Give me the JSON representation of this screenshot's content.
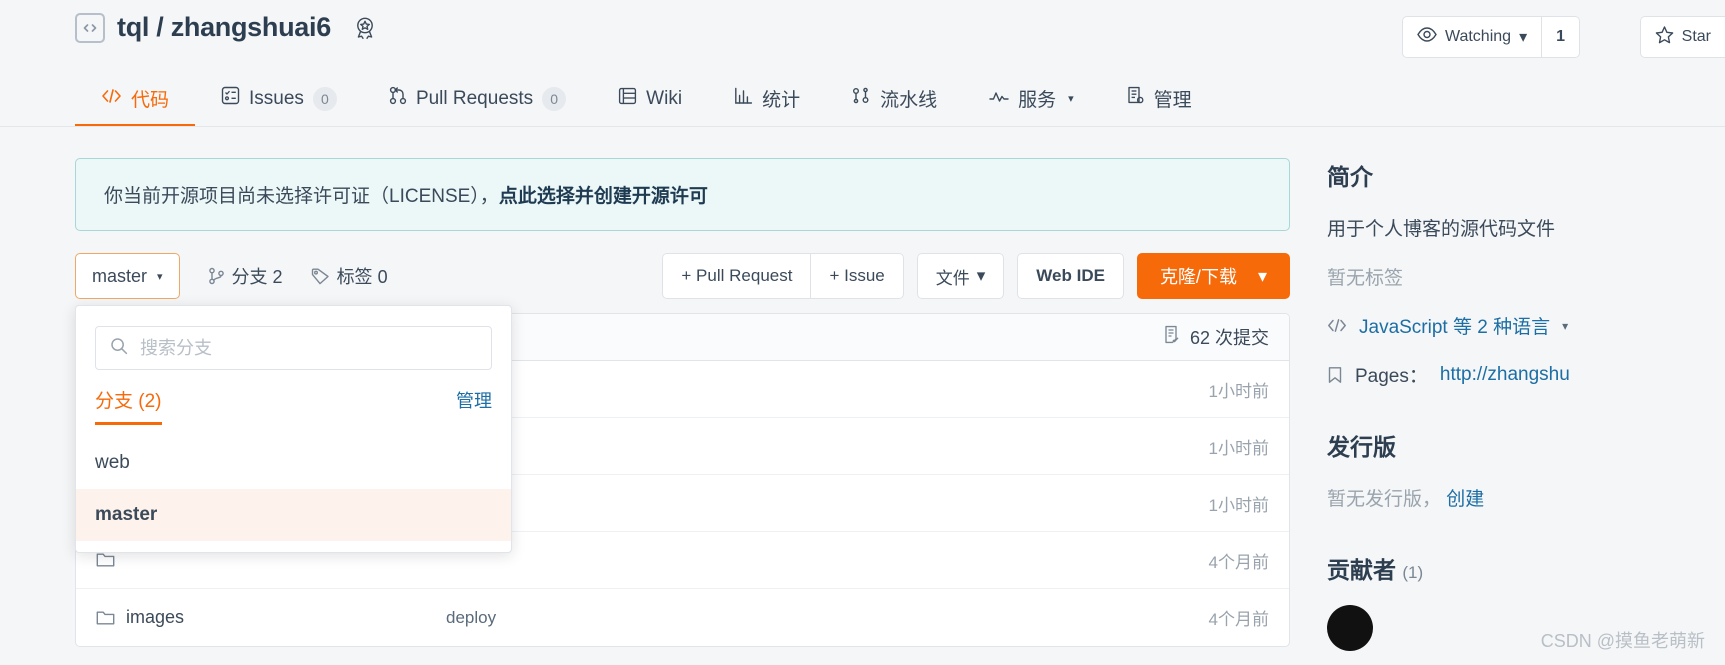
{
  "header": {
    "repo_icon": "code-brackets-icon",
    "owner": "tql",
    "separator": "/",
    "name": "zhangshuai6",
    "title": "tql / zhangshuai6",
    "badge_icon": "award-ribbon-icon",
    "watch_label": "Watching",
    "watch_count": "1",
    "star_label": "Star"
  },
  "tabs": [
    {
      "label": "代码",
      "icon": "code-icon",
      "count": "",
      "active": true,
      "caret": false
    },
    {
      "label": "Issues",
      "icon": "issues-icon",
      "count": "0",
      "active": false,
      "caret": false
    },
    {
      "label": "Pull Requests",
      "icon": "pull-request-icon",
      "count": "0",
      "active": false,
      "caret": false
    },
    {
      "label": "Wiki",
      "icon": "wiki-book-icon",
      "count": "",
      "active": false,
      "caret": false
    },
    {
      "label": "统计",
      "icon": "stats-bar-icon",
      "count": "",
      "active": false,
      "caret": false
    },
    {
      "label": "流水线",
      "icon": "pipeline-icon",
      "count": "",
      "active": false,
      "caret": false
    },
    {
      "label": "服务",
      "icon": "service-pulse-icon",
      "count": "",
      "active": false,
      "caret": true
    },
    {
      "label": "管理",
      "icon": "settings-doc-icon",
      "count": "",
      "active": false,
      "caret": false
    }
  ],
  "license_banner": {
    "text": "你当前开源项目尚未选择许可证（LICENSE），",
    "link": "点此选择并创建开源许可"
  },
  "toolbar": {
    "branch_label": "master",
    "branches_label": "分支 2",
    "tags_label": "标签 0",
    "pull_request_label": "+ Pull Request",
    "issue_label": "+ Issue",
    "files_label": "文件",
    "web_ide_label": "Web IDE",
    "clone_label": "克隆/下载"
  },
  "file_panel": {
    "commits_label": "62 次提交",
    "commits_icon": "commit-list-icon",
    "rows": [
      {
        "icon": "folder-icon",
        "name": "",
        "message": "",
        "time": "1小时前"
      },
      {
        "icon": "folder-icon",
        "name": "",
        "message": "",
        "time": "1小时前"
      },
      {
        "icon": "folder-icon",
        "name": "",
        "message": "",
        "time": "1小时前"
      },
      {
        "icon": "folder-icon",
        "name": "",
        "message": "",
        "time": "4个月前"
      },
      {
        "icon": "folder-icon",
        "name": "images",
        "message": "deploy",
        "time": "4个月前"
      }
    ]
  },
  "branch_dropdown": {
    "search_placeholder": "搜索分支",
    "search_value": "",
    "search_icon": "search-icon",
    "tab_label": "分支 (2)",
    "manage_label": "管理",
    "items": [
      {
        "label": "web",
        "selected": false
      },
      {
        "label": "master",
        "selected": true
      }
    ]
  },
  "sidebar": {
    "about_heading": "简介",
    "about_description": "用于个人博客的源代码文件",
    "no_tags": "暂无标签",
    "language_icon": "code-angle-icon",
    "language_text": "JavaScript 等 2 种语言",
    "pages_icon": "pages-bookmark-icon",
    "pages_label": "Pages：",
    "pages_url": "http://zhangshu",
    "releases_heading": "发行版",
    "no_release_text": "暂无发行版，",
    "create_release_link": "创建",
    "contributors_heading": "贡献者",
    "contributors_count": "(1)"
  },
  "watermark": "CSDN @摸鱼老萌新",
  "colors": {
    "accent": "#f66a0a",
    "link": "#1c6ea4",
    "text": "#3b4a5a",
    "banner_bg": "#ecf7f7",
    "banner_border": "#a9d6d6",
    "page_bg": "#f5f6f7"
  }
}
